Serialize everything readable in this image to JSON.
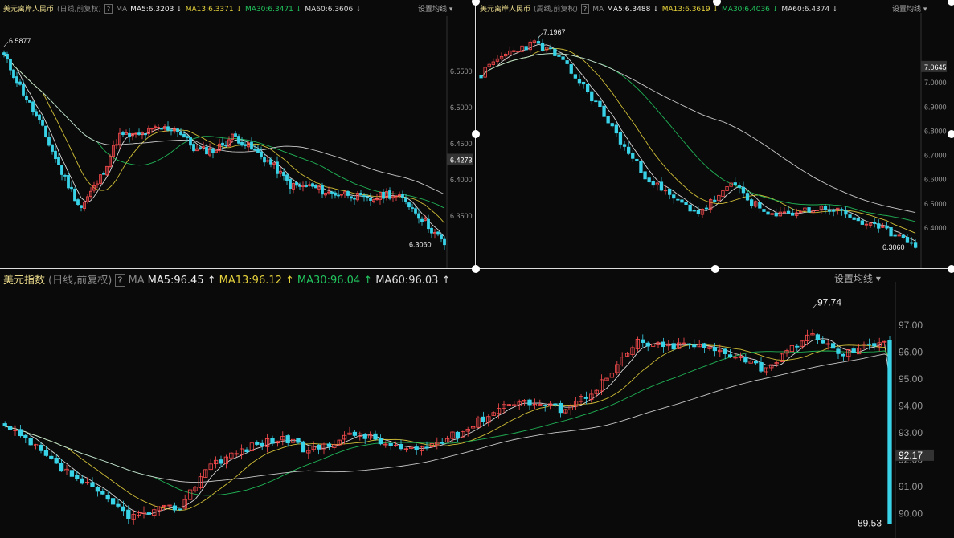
{
  "panels": [
    {
      "id": "tl",
      "symbol": "美元离岸人民币",
      "period": "(日线,前复权)",
      "help": "?",
      "ma_label": "MA",
      "ma": [
        {
          "name": "MA5",
          "text": "MA5:6.3203 ↓",
          "color": "#eeeeee"
        },
        {
          "name": "MA13",
          "text": "MA13:6.3371 ↓",
          "color": "#e6d23c"
        },
        {
          "name": "MA30",
          "text": "MA30:6.3471 ↓",
          "color": "#22c55e"
        },
        {
          "name": "MA60",
          "text": "MA60:6.3606 ↓",
          "color": "#dddddd"
        }
      ],
      "settings": "设置均线 ▾",
      "current_price": "6.4273",
      "high_label": "6.5877",
      "low_label": "6.3060"
    },
    {
      "id": "tr",
      "symbol": "美元离岸人民币",
      "period": "(周线,前复权)",
      "help": "?",
      "ma_label": "MA",
      "ma": [
        {
          "name": "MA5",
          "text": "MA5:6.3488 ↓",
          "color": "#eeeeee"
        },
        {
          "name": "MA13",
          "text": "MA13:6.3619 ↓",
          "color": "#e6d23c"
        },
        {
          "name": "MA30",
          "text": "MA30:6.4036 ↓",
          "color": "#22c55e"
        },
        {
          "name": "MA60",
          "text": "MA60:6.4374 ↓",
          "color": "#dddddd"
        }
      ],
      "settings": "设置均线 ▾",
      "current_price": "7.0645",
      "high_label": "7.1967",
      "low_label": "6.3060"
    },
    {
      "id": "bot",
      "symbol": "美元指数",
      "period": "(日线,前复权)",
      "help": "?",
      "ma_label": "MA",
      "ma": [
        {
          "name": "MA5",
          "text": "MA5:96.45 ↑",
          "color": "#eeeeee"
        },
        {
          "name": "MA13",
          "text": "MA13:96.12 ↑",
          "color": "#e6d23c"
        },
        {
          "name": "MA30",
          "text": "MA30:96.04 ↑",
          "color": "#22c55e"
        },
        {
          "name": "MA60",
          "text": "MA60:96.03 ↑",
          "color": "#dddddd"
        }
      ],
      "settings": "设置均线 ▾",
      "current_price": "92.17",
      "high_label": "97.74",
      "low_label": "89.53"
    }
  ],
  "chart_data": [
    {
      "type": "candlestick",
      "title": "美元离岸人民币 (日线,前复权)",
      "y_ticks": [
        "6.5500",
        "6.5000",
        "6.4500",
        "6.4000",
        "6.3500"
      ],
      "y_tick_values": [
        6.55,
        6.5,
        6.45,
        6.4,
        6.35
      ],
      "ylim": [
        6.29,
        6.61
      ],
      "annotations": {
        "high": 6.5877,
        "low": 6.306,
        "current": 6.4273
      },
      "anchors": [
        6.57,
        6.52,
        6.47,
        6.41,
        6.36,
        6.4,
        6.46,
        6.46,
        6.47,
        6.47,
        6.44,
        6.44,
        6.46,
        6.44,
        6.42,
        6.39,
        6.39,
        6.38,
        6.38,
        6.37,
        6.38,
        6.37,
        6.34,
        6.31
      ],
      "ma_end": {
        "MA5": 6.3203,
        "MA13": 6.3371,
        "MA30": 6.3471,
        "MA60": 6.3606
      },
      "ma_periods": [
        5,
        13,
        30,
        60
      ],
      "ma_colors": [
        "#eeeeee",
        "#e6d23c",
        "#22c55e",
        "#dddddd"
      ],
      "up_color": "#ff4d4f",
      "down_color": "#39d3e8",
      "grid": false
    },
    {
      "type": "candlestick",
      "title": "美元离岸人民币 (周线,前复权)",
      "y_ticks": [
        "7.0000",
        "6.9000",
        "6.8000",
        "6.7000",
        "6.6000",
        "6.5000",
        "6.4000"
      ],
      "y_tick_values": [
        7.0,
        6.9,
        6.8,
        6.7,
        6.6,
        6.5,
        6.4
      ],
      "ylim": [
        6.27,
        7.24
      ],
      "annotations": {
        "high": 7.1967,
        "low": 6.306,
        "current": 7.0645
      },
      "anchors": [
        7.03,
        7.1,
        7.14,
        7.16,
        7.12,
        7.04,
        6.95,
        6.84,
        6.72,
        6.62,
        6.55,
        6.5,
        6.46,
        6.52,
        6.58,
        6.5,
        6.44,
        6.46,
        6.47,
        6.48,
        6.46,
        6.42,
        6.39,
        6.37,
        6.34
      ],
      "ma_end": {
        "MA5": 6.3488,
        "MA13": 6.3619,
        "MA30": 6.4036,
        "MA60": 6.4374
      },
      "ma_periods": [
        5,
        13,
        30,
        60
      ],
      "ma_colors": [
        "#eeeeee",
        "#e6d23c",
        "#22c55e",
        "#dddddd"
      ],
      "up_color": "#ff4d4f",
      "down_color": "#39d3e8",
      "grid": false
    },
    {
      "type": "candlestick",
      "title": "美元指数 (日线,前复权)",
      "y_ticks": [
        "97.00",
        "96.00",
        "95.00",
        "94.00",
        "93.00",
        "92.00",
        "91.00",
        "90.00"
      ],
      "y_tick_values": [
        97,
        96,
        95,
        94,
        93,
        92,
        91,
        90
      ],
      "ylim": [
        89.3,
        98.2
      ],
      "annotations": {
        "high": 97.74,
        "low": 89.53,
        "current": 92.17
      },
      "anchors": [
        93.2,
        92.6,
        91.8,
        91.2,
        90.5,
        89.9,
        90.1,
        90.3,
        91.8,
        92.2,
        92.6,
        92.8,
        92.3,
        92.7,
        93.0,
        92.6,
        92.3,
        92.6,
        93.0,
        93.6,
        94.2,
        94.1,
        93.9,
        94.4,
        95.2,
        96.4,
        96.2,
        96.3,
        96.1,
        95.9,
        95.4,
        96.0,
        96.7,
        95.9,
        96.2,
        96.6
      ],
      "ma_end": {
        "MA5": 96.45,
        "MA13": 96.12,
        "MA30": 96.04,
        "MA60": 96.03
      },
      "ma_periods": [
        5,
        13,
        30,
        60
      ],
      "ma_colors": [
        "#eeeeee",
        "#e6d23c",
        "#22c55e",
        "#dddddd"
      ],
      "up_color": "#ff4d4f",
      "down_color": "#39d3e8",
      "grid": false
    }
  ]
}
